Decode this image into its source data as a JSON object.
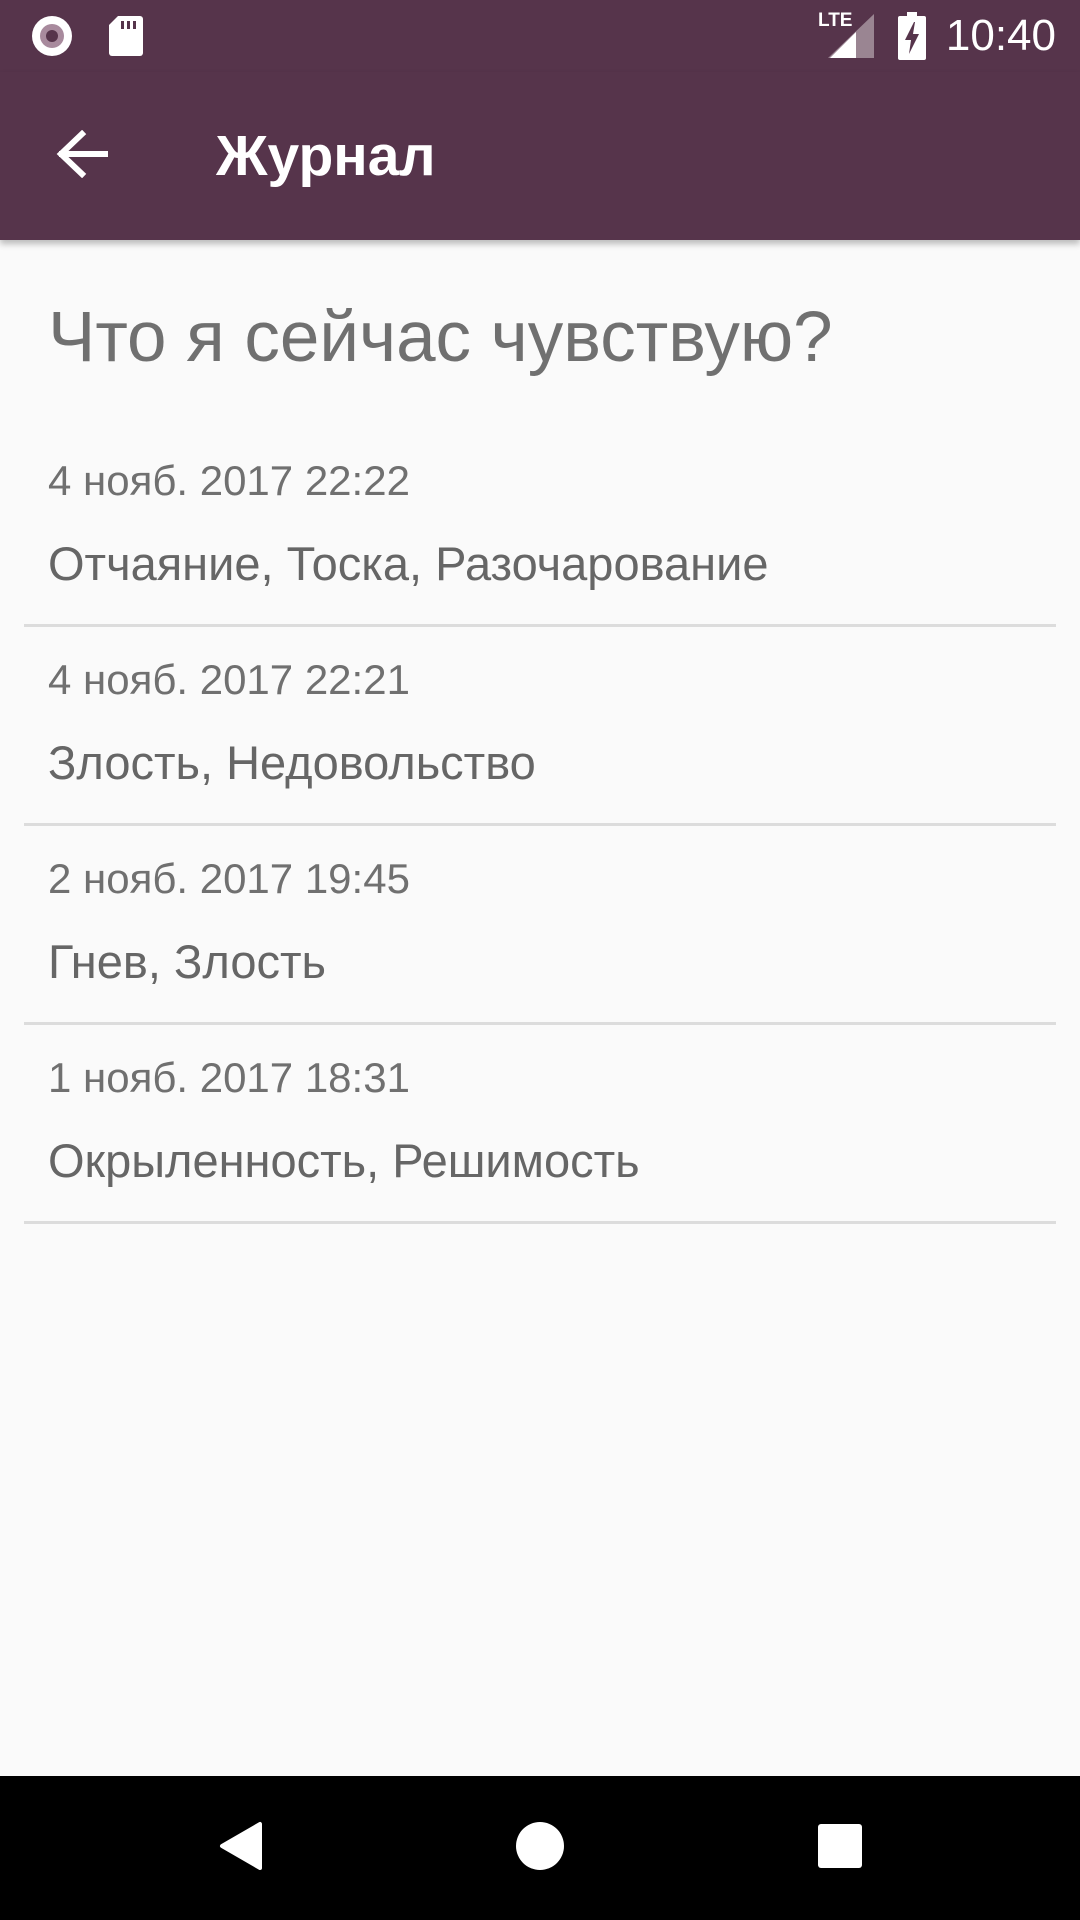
{
  "status_bar": {
    "time": "10:40",
    "network": "LTE",
    "icons": [
      "record-icon",
      "sd-card-icon",
      "lte-signal-icon",
      "battery-charging-icon"
    ]
  },
  "app_bar": {
    "title": "Журнал",
    "back_icon": "arrow-back-icon"
  },
  "page": {
    "heading": "Что я сейчас чувствую?"
  },
  "entries": [
    {
      "date": "4 нояб. 2017 22:22",
      "feelings": "Отчаяние, Тоска, Разочарование"
    },
    {
      "date": "4 нояб. 2017 22:21",
      "feelings": "Злость, Недовольство"
    },
    {
      "date": "2 нояб. 2017 19:45",
      "feelings": "Гнев, Злость"
    },
    {
      "date": "1 нояб. 2017 18:31",
      "feelings": "Окрыленность, Решимость"
    }
  ],
  "nav_bar": {
    "icons": [
      "nav-back-icon",
      "nav-home-icon",
      "nav-recents-icon"
    ]
  },
  "colors": {
    "primary": "#56344b",
    "background": "#fafafa",
    "divider": "#dcdcdc",
    "text_secondary": "#707070"
  }
}
